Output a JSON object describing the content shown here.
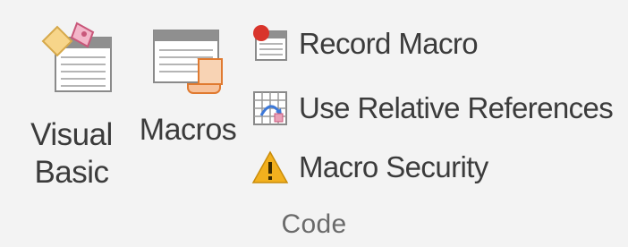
{
  "ribbon": {
    "group_label": "Code",
    "visual_basic": {
      "label_line1": "Visual",
      "label_line2": "Basic",
      "icon": "visual-basic-icon"
    },
    "macros": {
      "label": "Macros",
      "icon": "macros-icon"
    },
    "record_macro": {
      "label": "Record Macro",
      "icon": "record-macro-icon"
    },
    "relative_references": {
      "label": "Use Relative References",
      "icon": "relative-references-icon"
    },
    "macro_security": {
      "label": "Macro Security",
      "icon": "warning-icon"
    }
  },
  "colors": {
    "background": "#f3f3f3",
    "text": "#3b3b3b",
    "group_label": "#6a6a6a",
    "record_red": "#d9342b",
    "warning_yellow": "#f2b01e",
    "scroll_orange": "#f08a3c",
    "pink": "#e9a0b8",
    "blue_arrow": "#3c78d8"
  }
}
